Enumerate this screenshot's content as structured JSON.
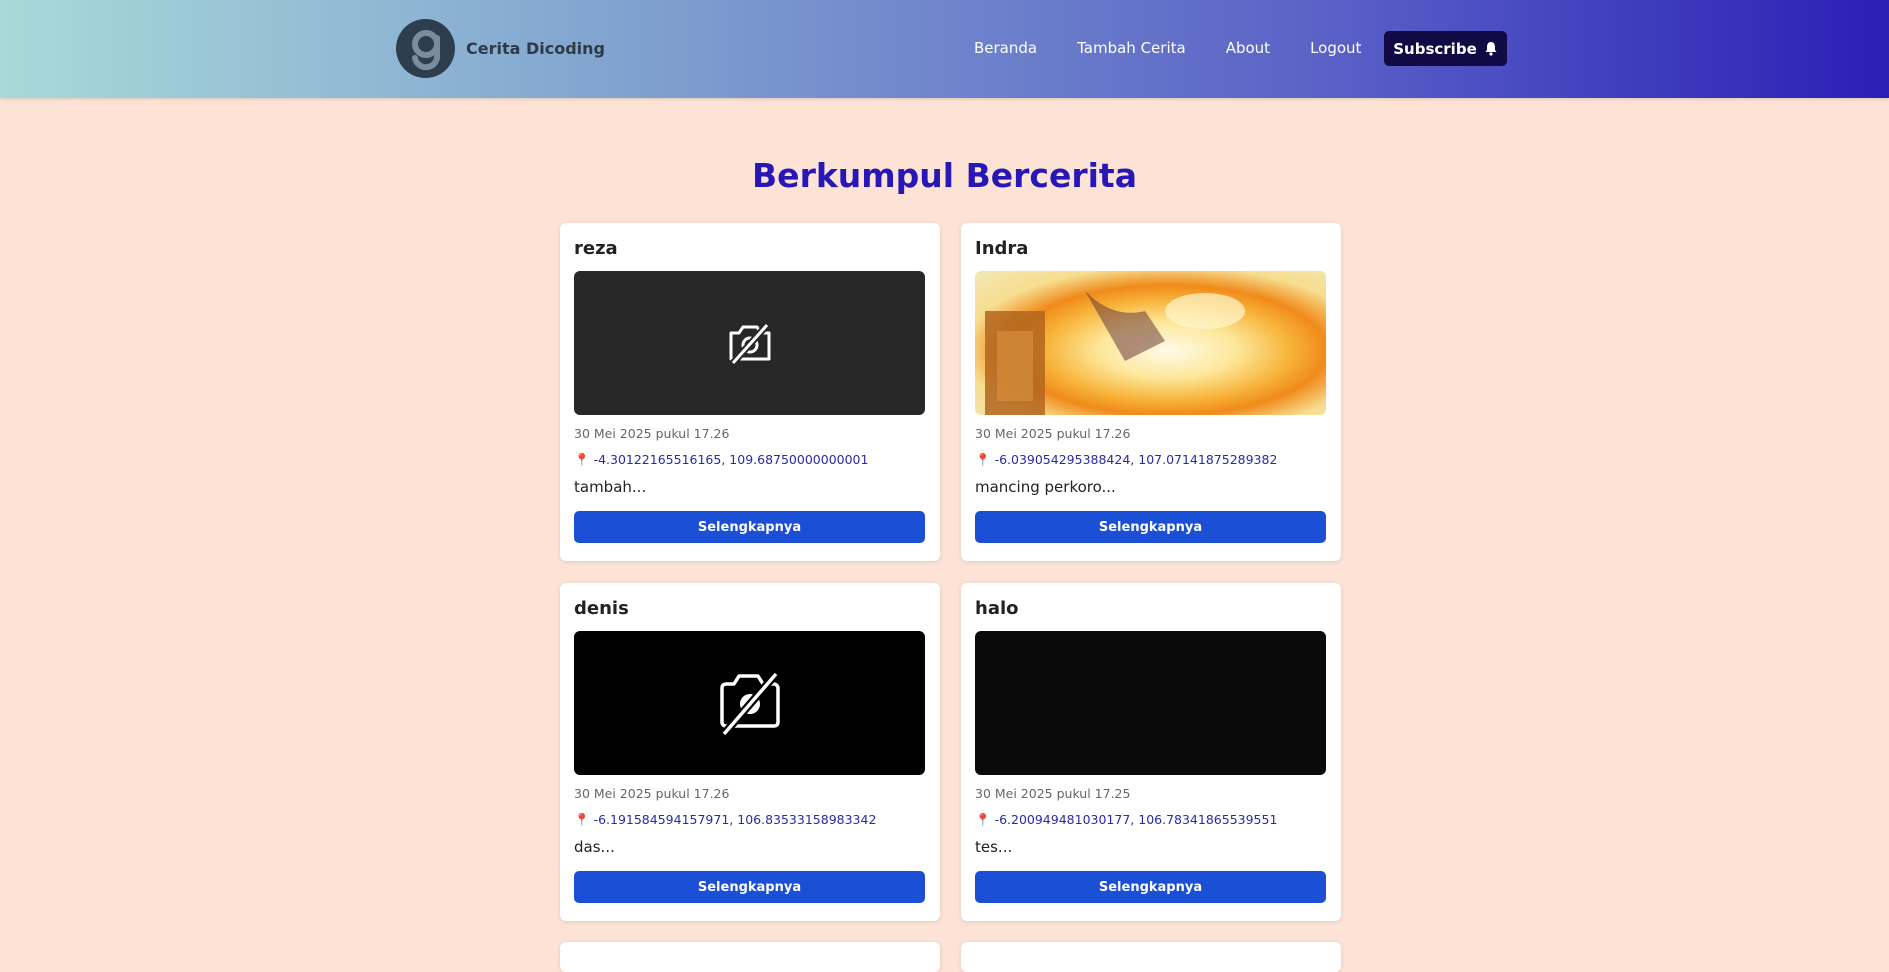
{
  "header": {
    "brand": "Cerita Dicoding",
    "nav": [
      "Beranda",
      "Tambah Cerita",
      "About",
      "Logout"
    ],
    "subscribe_label": "Subscribe"
  },
  "main": {
    "title": "Berkumpul Bercerita",
    "stories": [
      {
        "name": "reza",
        "image": "camera-off-icon-dark",
        "date": "30 Mei 2025 pukul 17.26",
        "location": "-4.30122165516165, 109.68750000000001",
        "description": "tambah...",
        "button": "Selengkapnya"
      },
      {
        "name": "Indra",
        "image": "photo-orange",
        "date": "30 Mei 2025 pukul 17.26",
        "location": "-6.039054295388424, 107.07141875289382",
        "description": "mancing perkoro...",
        "button": "Selengkapnya"
      },
      {
        "name": "denis",
        "image": "camera-off-icon-black",
        "date": "30 Mei 2025 pukul 17.26",
        "location": "-6.191584594157971, 106.83533158983342",
        "description": "das...",
        "button": "Selengkapnya"
      },
      {
        "name": "halo",
        "image": "photo-dark",
        "date": "30 Mei 2025 pukul 17.25",
        "location": "-6.200949481030177, 106.78341865539551",
        "description": "tes...",
        "button": "Selengkapnya"
      }
    ]
  },
  "colors": {
    "accent": "#2617b6",
    "button": "#1a4fd6",
    "background": "#fce3d6",
    "subscribe": "#120a45"
  },
  "icons": {
    "location": "📍"
  }
}
